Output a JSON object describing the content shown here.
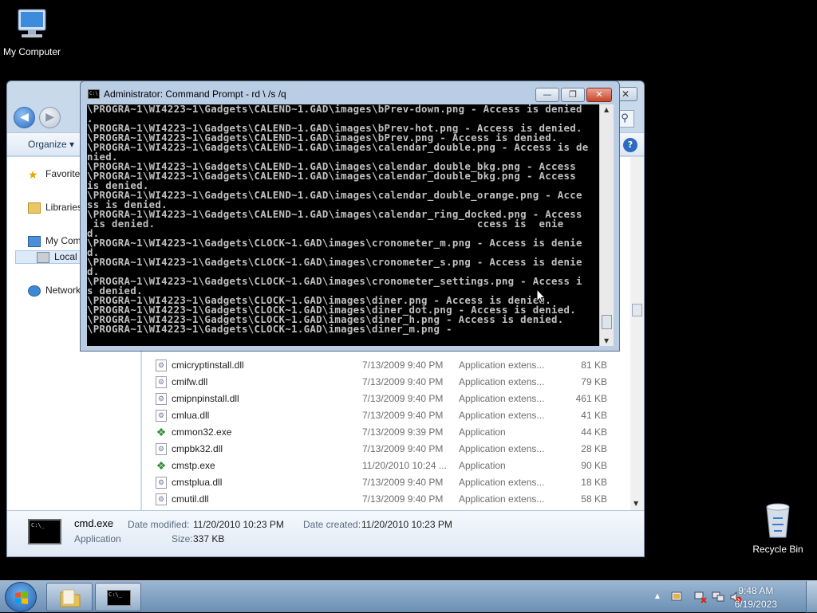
{
  "desktop": {
    "icons": [
      {
        "label": "My Computer"
      },
      {
        "label": "Recycle Bin"
      }
    ]
  },
  "explorer": {
    "close_label": "✕",
    "organize_label": "Organize",
    "nav": {
      "favorites": "Favorite",
      "libraries": "Libraries",
      "computer": "My Com",
      "local_disk": "Local",
      "network": "Network"
    },
    "files": [
      {
        "name": "cmicryptinstall.dll",
        "date": "7/13/2009 9:40 PM",
        "type": "Application extens...",
        "size": "81 KB",
        "icon": "dll"
      },
      {
        "name": "cmifw.dll",
        "date": "7/13/2009 9:40 PM",
        "type": "Application extens...",
        "size": "79 KB",
        "icon": "dll"
      },
      {
        "name": "cmipnpinstall.dll",
        "date": "7/13/2009 9:40 PM",
        "type": "Application extens...",
        "size": "461 KB",
        "icon": "dll"
      },
      {
        "name": "cmlua.dll",
        "date": "7/13/2009 9:40 PM",
        "type": "Application extens...",
        "size": "41 KB",
        "icon": "dll"
      },
      {
        "name": "cmmon32.exe",
        "date": "7/13/2009 9:39 PM",
        "type": "Application",
        "size": "44 KB",
        "icon": "exe"
      },
      {
        "name": "cmpbk32.dll",
        "date": "7/13/2009 9:40 PM",
        "type": "Application extens...",
        "size": "28 KB",
        "icon": "dll"
      },
      {
        "name": "cmstp.exe",
        "date": "11/20/2010 10:24 ...",
        "type": "Application",
        "size": "90 KB",
        "icon": "exe"
      },
      {
        "name": "cmstplua.dll",
        "date": "7/13/2009 9:40 PM",
        "type": "Application extens...",
        "size": "18 KB",
        "icon": "dll"
      },
      {
        "name": "cmutil.dll",
        "date": "7/13/2009 9:40 PM",
        "type": "Application extens...",
        "size": "58 KB",
        "icon": "dll"
      }
    ],
    "details": {
      "name": "cmd.exe",
      "type": "Application",
      "modified_label": "Date modified:",
      "modified_value": "11/20/2010 10:23 PM",
      "size_label": "Size:",
      "size_value": "337 KB",
      "created_label": "Date created:",
      "created_value": "11/20/2010 10:23 PM"
    }
  },
  "cmd": {
    "title": "Administrator:  Command Prompt - rd \\ /s /q",
    "minimize_label": "—",
    "maximize_label": "❐",
    "close_label": "✕",
    "lines": [
      "\\PROGRA~1\\WI4223~1\\Gadgets\\CALEND~1.GAD\\images\\bPrev-down.png - Access is denied",
      ".",
      "\\PROGRA~1\\WI4223~1\\Gadgets\\CALEND~1.GAD\\images\\bPrev-hot.png - Access is denied.",
      "",
      "\\PROGRA~1\\WI4223~1\\Gadgets\\CALEND~1.GAD\\images\\bPrev.png - Access is denied.",
      "\\PROGRA~1\\WI4223~1\\Gadgets\\CALEND~1.GAD\\images\\calendar_double.png - Access is de",
      "nied.",
      "\\PROGRA~1\\WI4223~1\\Gadgets\\CALEND~1.GAD\\images\\calendar_double_bkg.png - Access",
      "\\PROGRA~1\\WI4223~1\\Gadgets\\CALEND~1.GAD\\images\\calendar_double_bkg.png - Access",
      "is denied.",
      "\\PROGRA~1\\WI4223~1\\Gadgets\\CALEND~1.GAD\\images\\calendar_double_orange.png - Acce",
      "ss is denied.",
      "\\PROGRA~1\\WI4223~1\\Gadgets\\CALEND~1.GAD\\images\\calendar_ring_docked.png - Access",
      " is denied.                                                    ccess is  enie",
      "d.",
      "\\PROGRA~1\\WI4223~1\\Gadgets\\CLOCK~1.GAD\\images\\cronometer_m.png - Access is denie",
      "d.",
      "\\PROGRA~1\\WI4223~1\\Gadgets\\CLOCK~1.GAD\\images\\cronometer_s.png - Access is denie",
      "d.",
      "\\PROGRA~1\\WI4223~1\\Gadgets\\CLOCK~1.GAD\\images\\cronometer_settings.png - Access i",
      "s denied.",
      "\\PROGRA~1\\WI4223~1\\Gadgets\\CLOCK~1.GAD\\images\\diner.png - Access is denied.",
      "\\PROGRA~1\\WI4223~1\\Gadgets\\CLOCK~1.GAD\\images\\diner_dot.png - Access is denied.",
      "\\PROGRA~1\\WI4223~1\\Gadgets\\CLOCK~1.GAD\\images\\diner_h.png - Access is denied.",
      "\\PROGRA~1\\WI4223~1\\Gadgets\\CLOCK~1.GAD\\images\\diner_m.png -"
    ]
  },
  "taskbar": {
    "clock_time": "9:48 AM",
    "clock_date": "6/19/2023",
    "tray_expand": "▲"
  },
  "colors": {
    "desktop_bg": "#000000",
    "console_bg": "#000000",
    "console_text": "#c0c0c0",
    "taskbar": "#7d9fc2"
  }
}
